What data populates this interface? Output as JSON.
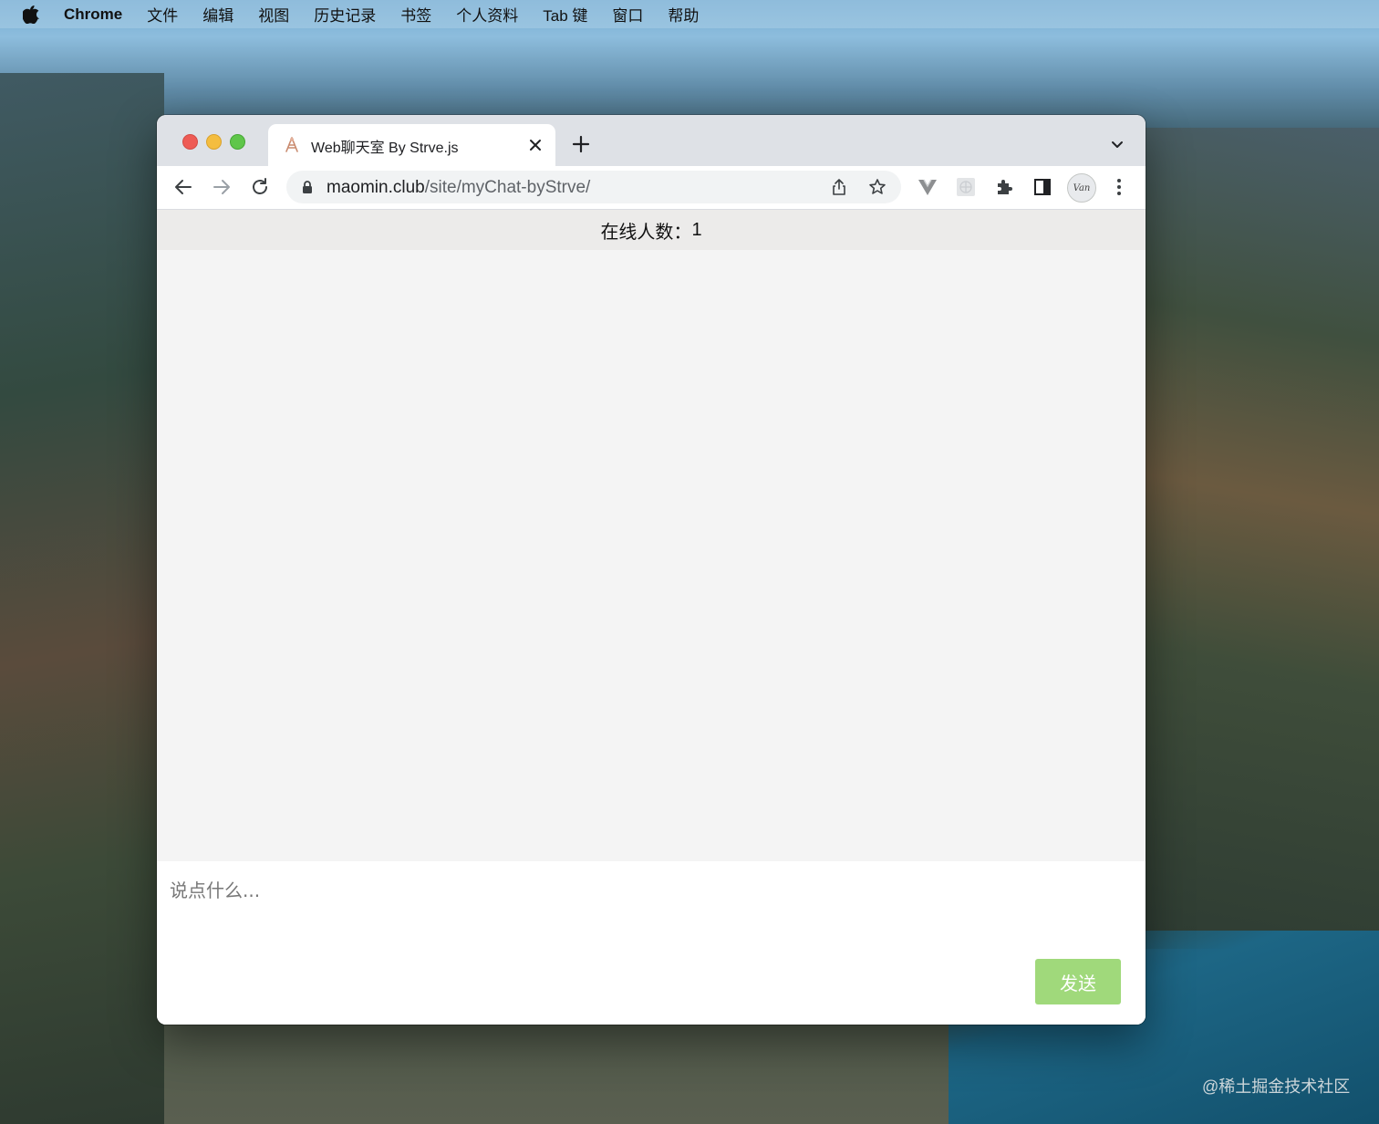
{
  "menubar": {
    "app_name": "Chrome",
    "items": [
      "文件",
      "编辑",
      "视图",
      "历史记录",
      "书签",
      "个人资料",
      "Tab 键",
      "窗口",
      "帮助"
    ]
  },
  "browser": {
    "tab": {
      "title": "Web聊天室 By Strve.js",
      "favicon": "chat-app-favicon"
    },
    "address": {
      "host": "maomin.club",
      "path": "/site/myChat-byStrve/"
    },
    "profile_label": "Van"
  },
  "page": {
    "online_label": "在线人数：",
    "online_count": "1",
    "input_placeholder": "说点什么...",
    "send_label": "发送"
  },
  "watermark": "@稀土掘金技术社区",
  "colors": {
    "send_button": "#a0d97b",
    "online_bar_bg": "#ecebea",
    "messages_bg": "#f4f4f4",
    "traffic_red": "#ee5b55",
    "traffic_yellow": "#f4bd3f",
    "traffic_green": "#5fc64a"
  }
}
